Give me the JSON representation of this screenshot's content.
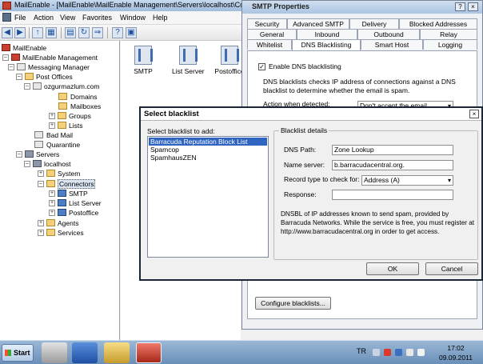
{
  "mmc": {
    "title": "MailEnable - [MailEnable\\MailEnable Management\\Servers\\localhost\\Connectors]",
    "menu": [
      "File",
      "Action",
      "View",
      "Favorites",
      "Window",
      "Help"
    ],
    "tree": {
      "root": "MailEnable",
      "management": "MailEnable Management",
      "messaging_manager": "Messaging Manager",
      "post_offices": "Post Offices",
      "postoffice_name": "ozgurmazlum.com",
      "domains": "Domains",
      "mailboxes": "Mailboxes",
      "groups": "Groups",
      "lists": "Lists",
      "bad_mail": "Bad Mail",
      "quarantine": "Quarantine",
      "servers": "Servers",
      "localhost": "localhost",
      "system": "System",
      "connectors": "Connectors",
      "smtp": "SMTP",
      "list_server": "List Server",
      "postoffice": "Postoffice",
      "agents": "Agents",
      "services": "Services"
    },
    "list_items": [
      "SMTP",
      "List Server",
      "Postoffice"
    ]
  },
  "smtp_props": {
    "title": "SMTP Properties",
    "tabs_row1": [
      "Security",
      "Advanced SMTP",
      "Delivery",
      "Blocked Addresses"
    ],
    "tabs_row2": [
      "General",
      "Inbound",
      "Outbound",
      "Relay"
    ],
    "tabs_row3": [
      "Whitelist",
      "DNS Blacklisting",
      "Smart Host",
      "Logging"
    ],
    "enable_label": "Enable DNS blacklisting",
    "enable_checked": "✓",
    "description": "DNS blacklists checks IP address of connections against a DNS blacklist to determine whether the email is spam.",
    "action_label": "Action when detected:",
    "action_value": "Don't accept the email",
    "configure_button": "Configure blacklists..."
  },
  "select_blacklist": {
    "title": "Select blacklist",
    "list_label": "Select blacklist to add:",
    "items": [
      "Barracuda Reputation Block List",
      "Spamcop",
      "SpamhausZEN"
    ],
    "details_title": "Blacklist details",
    "dns_path_label": "DNS Path:",
    "dns_path_value": "Zone Lookup",
    "name_server_label": "Name server:",
    "name_server_value": "b.barracudacentral.org.",
    "record_type_label": "Record type to check for:",
    "record_type_value": "Address (A)",
    "response_label": "Response:",
    "response_value": "",
    "description": "DNSBL of IP addresses known to send spam, provided by Barracuda Networks. While the service is free, you must register at http://www.barracudacentral.org in order to get access.",
    "ok_label": "OK",
    "cancel_label": "Cancel"
  },
  "taskbar": {
    "start_label": "Start",
    "language": "TR",
    "time": "17:02",
    "date": "09.09.2011"
  }
}
